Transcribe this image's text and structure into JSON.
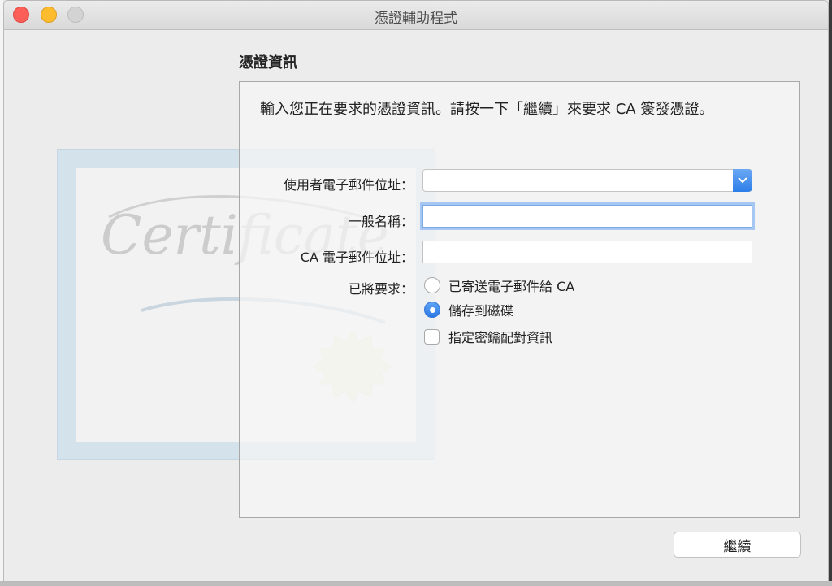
{
  "window": {
    "title": "憑證輔助程式"
  },
  "section": {
    "heading": "憑證資訊"
  },
  "intro_text": "輸入您正在要求的憑證資訊。請按一下「繼續」來要求 CA 簽發憑證。",
  "artwork": {
    "script_text": "Certificate"
  },
  "form": {
    "user_email_label": "使用者電子郵件位址：",
    "user_email_value": "",
    "common_name_label": "一般名稱：",
    "common_name_value": "",
    "ca_email_label": "CA 電子郵件位址：",
    "ca_email_value": "",
    "request_label": "已將要求：",
    "option_email": "已寄送電子郵件給 CA",
    "option_disk": "儲存到磁碟",
    "selected_option": "儲存到磁碟",
    "key_pair_label": "指定密鑰配對資訊",
    "key_pair_checked": false
  },
  "buttons": {
    "continue": "繼續"
  },
  "colors": {
    "accent": "#2d7ee8",
    "close": "#fc5f57",
    "minimize": "#fdbc2e",
    "zoom": "#d3d3d3"
  }
}
